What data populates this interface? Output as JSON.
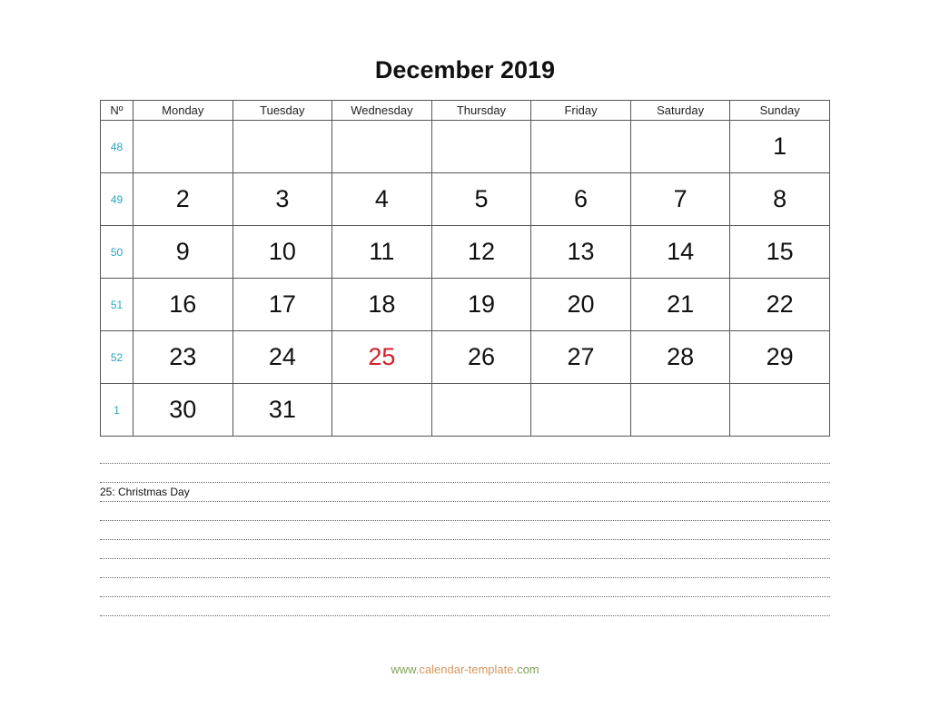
{
  "title": "December 2019",
  "headers": [
    "Nº",
    "Monday",
    "Tuesday",
    "Wednesday",
    "Thursday",
    "Friday",
    "Saturday",
    "Sunday"
  ],
  "weeks": [
    {
      "week": "48",
      "days": [
        "",
        "",
        "",
        "",
        "",
        "",
        "1"
      ]
    },
    {
      "week": "49",
      "days": [
        "2",
        "3",
        "4",
        "5",
        "6",
        "7",
        "8"
      ]
    },
    {
      "week": "50",
      "days": [
        "9",
        "10",
        "11",
        "12",
        "13",
        "14",
        "15"
      ]
    },
    {
      "week": "51",
      "days": [
        "16",
        "17",
        "18",
        "19",
        "20",
        "21",
        "22"
      ]
    },
    {
      "week": "52",
      "days": [
        "23",
        "24",
        "25",
        "26",
        "27",
        "28",
        "29"
      ]
    },
    {
      "week": "1",
      "days": [
        "30",
        "31",
        "",
        "",
        "",
        "",
        ""
      ]
    }
  ],
  "holidays": [
    "25"
  ],
  "notes": [
    "",
    "25: Christmas Day",
    "",
    "",
    "",
    "",
    "",
    "",
    ""
  ],
  "footer": {
    "prefix": "www.",
    "middle": "calendar-template",
    "suffix": ".com"
  },
  "colors": {
    "week_number": "#2aa3c4",
    "holiday": "#d0202a",
    "footer_green": "#7fa35a",
    "footer_orange": "#d6965c"
  }
}
